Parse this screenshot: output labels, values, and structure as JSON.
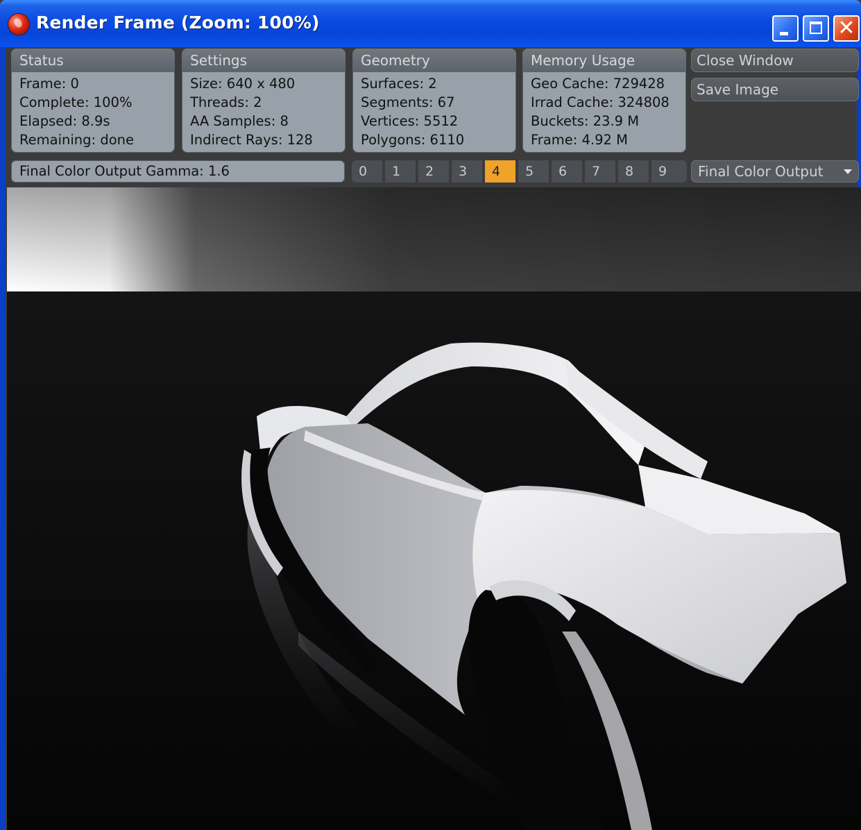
{
  "window": {
    "title": "Render Frame (Zoom: 100%)",
    "controls": [
      "minimize",
      "maximize",
      "close"
    ],
    "close_glyph": "✕"
  },
  "panels": {
    "status": {
      "title": "Status",
      "rows": [
        "Frame: 0",
        "Complete: 100%",
        "Elapsed: 8.9s",
        "Remaining: done"
      ]
    },
    "settings": {
      "title": "Settings",
      "rows": [
        "Size: 640 x 480",
        "Threads: 2",
        "AA Samples: 8",
        "Indirect Rays: 128"
      ]
    },
    "geometry": {
      "title": "Geometry",
      "rows": [
        "Surfaces: 2",
        "Segments: 67",
        "Vertices: 5512",
        "Polygons: 6110"
      ]
    },
    "memory": {
      "title": "Memory Usage",
      "rows": [
        "Geo Cache: 729428",
        "Irrad Cache: 324808",
        "Buckets: 23.9 M",
        "Frame: 4.92 M"
      ]
    }
  },
  "buttons": {
    "close_window": "Close Window",
    "save_image": "Save Image"
  },
  "gamma_field": "Final Color Output Gamma: 1.6",
  "buffer_tabs": {
    "items": [
      "0",
      "1",
      "2",
      "3",
      "4",
      "5",
      "6",
      "7",
      "8",
      "9"
    ],
    "active": "4"
  },
  "output_select": {
    "value": "Final Color Output"
  },
  "colors": {
    "title_bar": "#0a4ae0",
    "panel_bg": "#98a1a9",
    "active_tab": "#f0a22a",
    "close_button": "#e04a1e"
  }
}
